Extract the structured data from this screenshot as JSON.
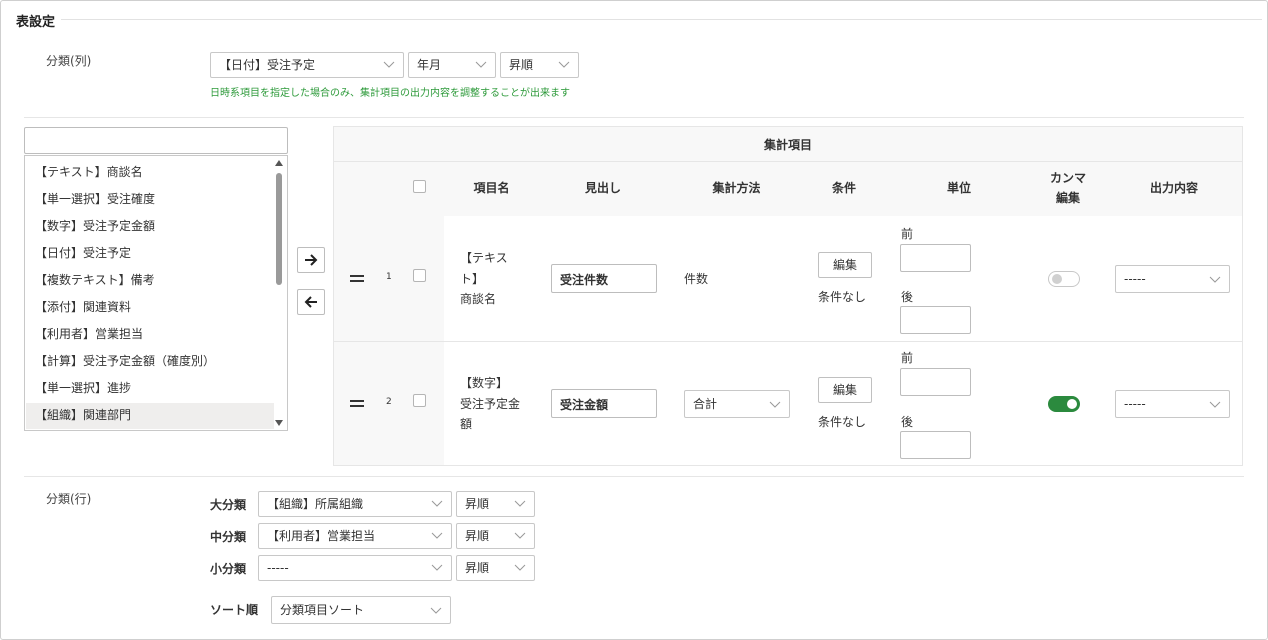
{
  "section_title": "表設定",
  "column_classification": {
    "label": "分類(列)",
    "field": "【日付】受注予定",
    "granularity": "年月",
    "order": "昇順",
    "note": "日時系項目を指定した場合のみ、集計項目の出力内容を調整することが出来ます"
  },
  "field_list": {
    "search_value": "",
    "items": [
      "【テキスト】商談名",
      "【単一選択】受注確度",
      "【数字】受注予定金額",
      "【日付】受注予定",
      "【複数テキスト】備考",
      "【添付】関連資料",
      "【利用者】営業担当",
      "【計算】受注予定金額（確度別）",
      "【単一選択】進捗",
      "【組織】関連部門"
    ],
    "selected_index": 9
  },
  "agg_table": {
    "title": "集計項目",
    "headers": {
      "item_name": "項目名",
      "heading": "見出し",
      "method": "集計方法",
      "condition": "条件",
      "unit": "単位",
      "comma_line1": "カンマ",
      "comma_line2": "編集",
      "output": "出力内容"
    },
    "unit_before": "前",
    "unit_after": "後",
    "edit_label": "編集",
    "rows": [
      {
        "num": "1",
        "name_lines": [
          "【テキス",
          "ト】",
          "商談名"
        ],
        "heading_value": "受注件数",
        "method": "件数",
        "condition_status": "条件なし",
        "comma": false,
        "output": "-----"
      },
      {
        "num": "2",
        "name_lines": [
          "【数字】",
          "受注予定金",
          "額"
        ],
        "heading_value": "受注金額",
        "method": "合計",
        "condition_status": "条件なし",
        "comma": true,
        "output": "-----"
      }
    ]
  },
  "row_classification": {
    "label": "分類(行)",
    "major_label": "大分類",
    "major_field": "【組織】所属組織",
    "major_order": "昇順",
    "middle_label": "中分類",
    "middle_field": "【利用者】営業担当",
    "middle_order": "昇順",
    "minor_label": "小分類",
    "minor_field": "-----",
    "minor_order": "昇順",
    "sort_label": "ソート順",
    "sort_value": "分類項目ソート"
  },
  "colors": {
    "note_green": "#2d9a3a",
    "toggle_on": "#2b8a3e",
    "border": "#c8c8c8"
  },
  "icons": {
    "move_right": "arrow-right-icon",
    "move_left": "arrow-left-icon",
    "drag": "drag-handle-icon",
    "dropdown": "chevron-down-icon"
  }
}
